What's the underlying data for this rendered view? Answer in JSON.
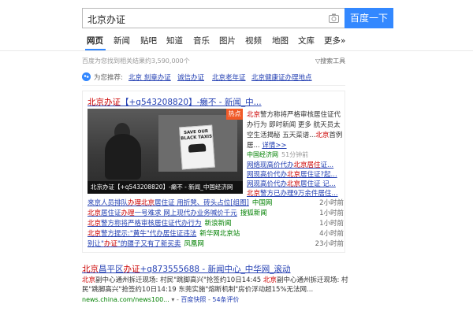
{
  "search": {
    "query": "北京办证",
    "button_label": "百度一下"
  },
  "tabs": [
    "网页",
    "新闻",
    "贴吧",
    "知道",
    "音乐",
    "图片",
    "视频",
    "地图",
    "文库",
    "更多»"
  ],
  "result_count": "百度为您找到相关结果约3,590,000个",
  "tools_label": "搜索工具",
  "recommend": {
    "label": "为您推荐:",
    "items": [
      "北京 刻章办证",
      "诚信办证",
      "北京老年证",
      "北京健康证办理地点"
    ]
  },
  "card": {
    "title_prefix": "北京办证",
    "title_rest": "【+q543208820】-癞不 - 新闻_中...",
    "hot_badge": "热点",
    "image_caption": "北京办证【+q543208820】-癞不 - 新闻_中国经济网",
    "sign_text": "SAVE OUR BLACK TAXIS",
    "desc_red_1": "北京",
    "desc_text_1": "警方称将严格审核居住证代办行为 即时新闻 更多 航天员太空生活揭秘 五天菜谱...",
    "desc_red_2": "北京",
    "desc_text_2": "首例居...",
    "desc_more": "详情>>",
    "source": "中国经济网",
    "time": "51分钟前",
    "sub_links": [
      {
        "pre": "网络现高价代办",
        "red": "北京居住",
        "post": "证..."
      },
      {
        "pre": "网现高价代办",
        "red": "北京",
        "post": "居住证?起..."
      },
      {
        "pre": "网现高价代办",
        "red": "北京",
        "post": "居住证 记..."
      },
      {
        "pre": "",
        "red": "北京",
        "post": "警方已办理9万余件居住..."
      }
    ],
    "list": [
      {
        "pre": "来京人员排队",
        "red": "办理北京",
        "post": "居住证 用折凳、砖头占位[组图]",
        "source": "中国网",
        "time": "2小时前"
      },
      {
        "pre": "",
        "red": "北京",
        "post": "居住证",
        "red2": "办理",
        "post2": "一号难求 网上现代办业务喊价千元",
        "source": "搜狐新闻",
        "time": "1小时前"
      },
      {
        "pre": "",
        "red": "北京",
        "post": "警方称将严格审核居住证代办行为",
        "source": "新浪新闻",
        "time": "1小时前"
      },
      {
        "pre": "",
        "red": "北京",
        "post": "警方提示:\"黄牛\"代办居住证违法",
        "source": "新华网北京站",
        "time": "4小时前"
      },
      {
        "pre": "别让\"",
        "red": "办证",
        "post": "\"的疆子又有了新买卖",
        "source": "凤凰网",
        "time": "23小时前"
      }
    ]
  },
  "result2": {
    "title_red": "北京",
    "title_mid": "昌平区",
    "title_red2": "办证",
    "title_rest": "+q873555688 - 新闻中心_中华网_滚动",
    "abstract_red_1": "北京",
    "abstract_text_1": "副中心通州拆迁现场: 村民\"跳脚高兴\"抢签约10日14:45 ",
    "abstract_red_2": "北京",
    "abstract_text_2": "副中心通州拆迁现场: 村民\"跳脚高兴\"抢签约10日14:19 东莞实施\"熔断机制\"房价浮动超15%无法网...",
    "url": "news.china.com/news100...",
    "snapshot": "百度快照",
    "reviews": "54条评价"
  },
  "colors": {
    "accent": "#3388ff",
    "link": "#2440b3",
    "highlight": "#cc0000",
    "url_green": "#008000",
    "hot_badge": "#f05a28"
  }
}
